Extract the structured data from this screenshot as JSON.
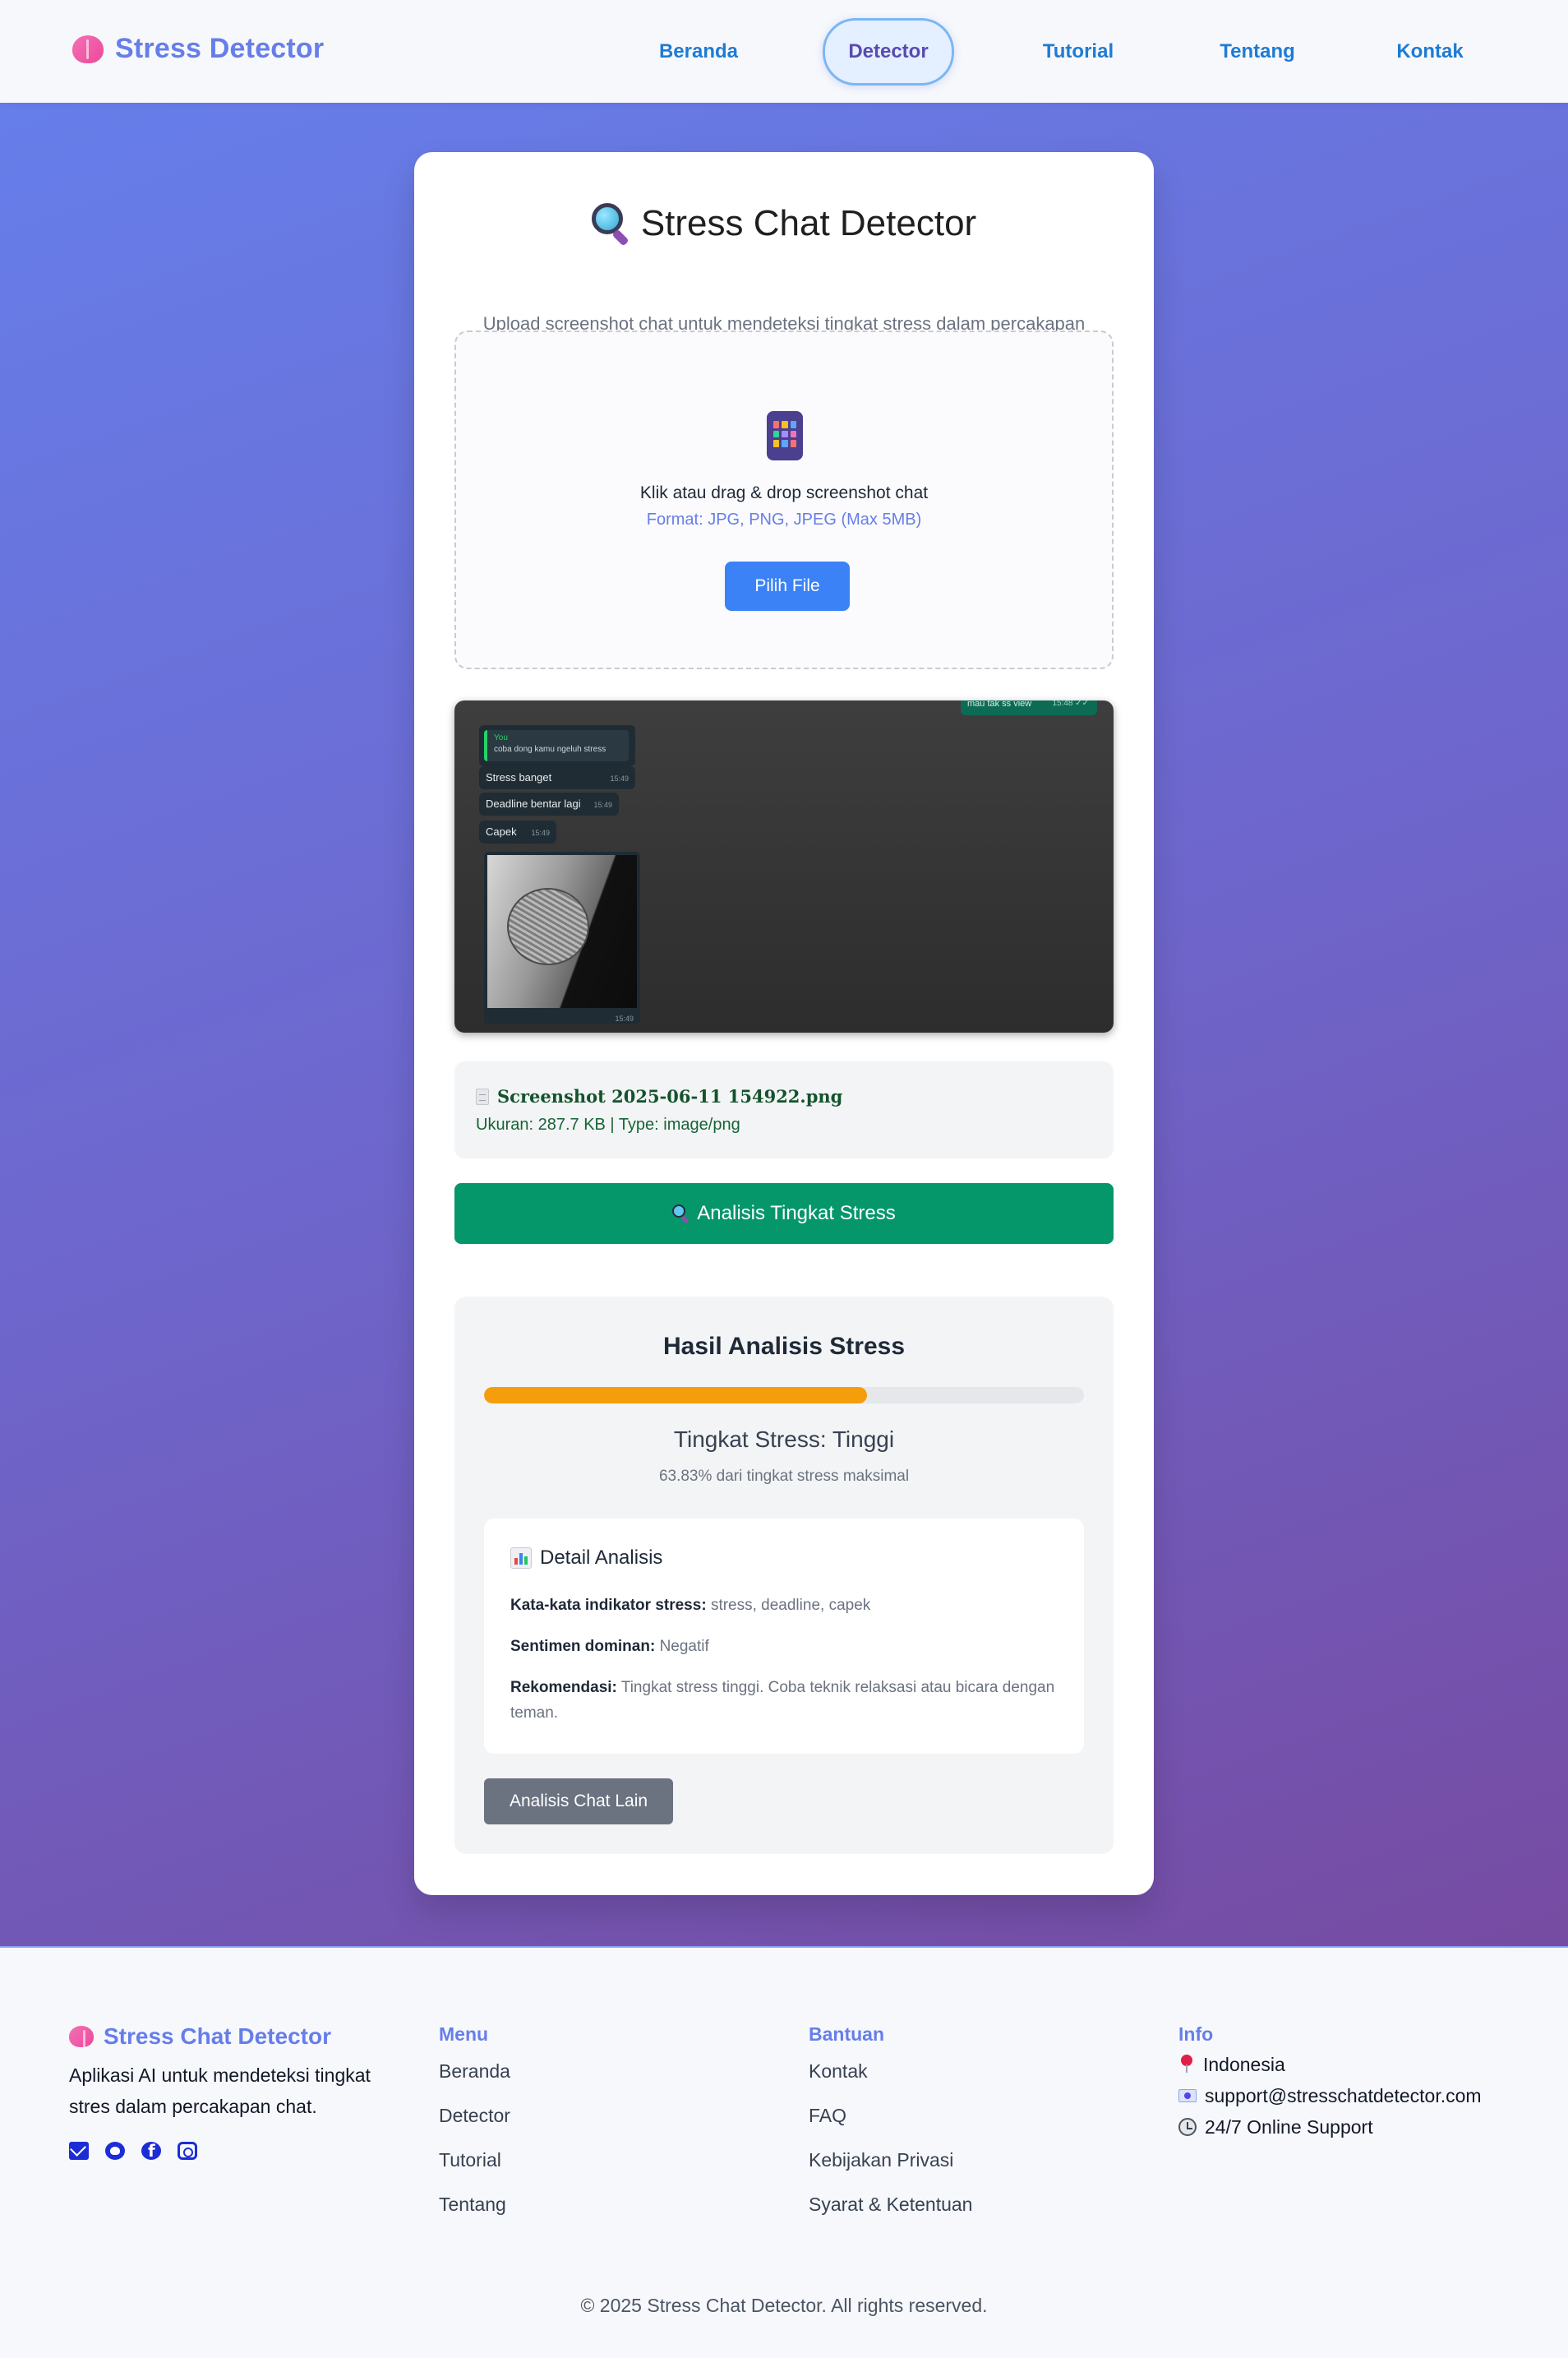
{
  "nav": {
    "brand": "Stress Detector",
    "items": [
      {
        "label": "Beranda",
        "active": false
      },
      {
        "label": "Detector",
        "active": true
      },
      {
        "label": "Tutorial",
        "active": false
      },
      {
        "label": "Tentang",
        "active": false
      },
      {
        "label": "Kontak",
        "active": false
      }
    ]
  },
  "card": {
    "title": "Stress Chat Detector",
    "subtitle": "Upload screenshot chat untuk mendeteksi tingkat stress dalam percakapan"
  },
  "upload": {
    "instruction": "Klik atau drag & drop screenshot chat",
    "format": "Format: JPG, PNG, JPEG (Max 5MB)",
    "button": "Pilih File"
  },
  "preview": {
    "top_bubble": "mau tak ss view",
    "top_time": "15:48 ✓✓",
    "reply_author": "You",
    "reply_text": "coba dong kamu ngeluh stress",
    "messages": [
      {
        "text": "Stress banget",
        "time": "15:49"
      },
      {
        "text": "Deadline bentar lagi",
        "time": "15:49"
      },
      {
        "text": "Capek",
        "time": "15:49"
      }
    ],
    "image_time": "15:49"
  },
  "file": {
    "name": "Screenshot 2025-06-11 154922.png",
    "meta": "Ukuran: 287.7 KB | Type: image/png"
  },
  "analyze_button": "Analisis Tingkat Stress",
  "result": {
    "title": "Hasil Analisis Stress",
    "stress_fraction": 0.6383,
    "level": "Tingkat Stress: Tinggi",
    "percentage_text": "63.83% dari tingkat stress maksimal",
    "detail_title": "Detail Analisis",
    "indicators_label": "Kata-kata indikator stress:",
    "indicators_value": "stress, deadline, capek",
    "sentiment_label": "Sentimen dominan:",
    "sentiment_value": "Negatif",
    "recommendation_label": "Rekomendasi:",
    "recommendation_value": "Tingkat stress tinggi. Coba teknik relaksasi atau bicara dengan teman.",
    "again_button": "Analisis Chat Lain"
  },
  "footer": {
    "brand": "Stress Chat Detector",
    "description": "Aplikasi AI untuk mendeteksi tingkat stres dalam percakapan chat.",
    "menu_title": "Menu",
    "menu": [
      "Beranda",
      "Detector",
      "Tutorial",
      "Tentang"
    ],
    "help_title": "Bantuan",
    "help": [
      "Kontak",
      "FAQ",
      "Kebijakan Privasi",
      "Syarat & Ketentuan"
    ],
    "info_title": "Info",
    "info": {
      "location": "Indonesia",
      "email": "support@stresschatdetector.com",
      "support": "24/7 Online Support"
    },
    "copyright": "© 2025 Stress Chat Detector. All rights reserved."
  },
  "colors": {
    "brand": "#667eea",
    "gradient_start": "#667eea",
    "gradient_end": "#764ba2",
    "analyze_button": "#059669",
    "stress_bar": "#f59e0b",
    "file_button": "#3b82f6"
  }
}
